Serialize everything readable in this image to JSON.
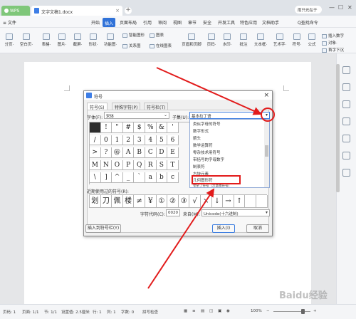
{
  "titlebar": {
    "app_tab": "WPS",
    "doc_tab": "文字文稿1.docx",
    "user": "雨只光在于"
  },
  "menu": {
    "file": "≡ 文件",
    "items": [
      "开始",
      "插入",
      "页面布局",
      "引用",
      "审阅",
      "视图",
      "章节",
      "安全",
      "开发工具",
      "特色应用",
      "文档助手"
    ],
    "active": "插入",
    "search": "Q查找命令"
  },
  "ribbon": {
    "big": [
      "分页·",
      "空白页·",
      "表格·",
      "图片·",
      "截屏·",
      "形状·",
      "功能图·",
      "图表",
      "页眉和页脚",
      "页码·",
      "水印·",
      "批注",
      "文本框·",
      "艺术字·",
      "符号·",
      "公式"
    ],
    "small": [
      "智能图形",
      "关系图",
      "在线图表",
      "插入数字",
      "对象·",
      "首字下沉"
    ]
  },
  "dialog": {
    "title": "符号",
    "tabs": [
      "符号(S)",
      "特殊字符(P)",
      "符号栏(T)"
    ],
    "font_label": "字体(F):",
    "font_value": "宋体",
    "subset_label": "子集(U):",
    "subset_value": "基本拉丁语",
    "symbols": [
      [
        "",
        "!",
        "\"",
        "#",
        "$",
        "%",
        "&",
        "'"
      ],
      [
        "/",
        "0",
        "1",
        "2",
        "3",
        "4",
        "5",
        "6"
      ],
      [
        ">",
        "?",
        "@",
        "A",
        "B",
        "C",
        "D",
        "E"
      ],
      [
        "M",
        "N",
        "O",
        "P",
        "Q",
        "R",
        "S",
        "T"
      ],
      [
        "\\",
        "]",
        "^",
        "_",
        "`",
        "a",
        "b",
        "c"
      ]
    ],
    "dropdown_items": [
      "类似字母的符号",
      "数字形式",
      "箭头",
      "数学运算符",
      "零杂技术用符号",
      "带括号的字母数字",
      "制表符",
      "方块元素",
      "几何图形符",
      "零杂了符号（示意图符号）"
    ],
    "recent_label": "近期使用过的符号(R):",
    "recent": [
      "划",
      "刀",
      "佩",
      "楼",
      "≠",
      "¥",
      "①",
      "②",
      "③",
      "√",
      "×",
      "↓",
      "→",
      "↑",
      ""
    ],
    "code_label": "字符代码(C):",
    "code_value": "0020",
    "from_label": "来自(M):",
    "from_value": "Unicode(十六进制)",
    "insert_bar_btn": "插入到符号栏(Y)",
    "insert_btn": "插入(I)",
    "cancel_btn": "取消"
  },
  "statusbar": {
    "items": [
      "页码: 1",
      "页面: 1/1",
      "节: 1/1",
      "设置值: 2.5厘米",
      "行: 1",
      "列: 1",
      "字数: 0",
      "拼写检查"
    ],
    "zoom": "100%"
  },
  "annotation": {
    "highlight_color": "#e21b1b"
  },
  "watermark": "Baidu经验"
}
